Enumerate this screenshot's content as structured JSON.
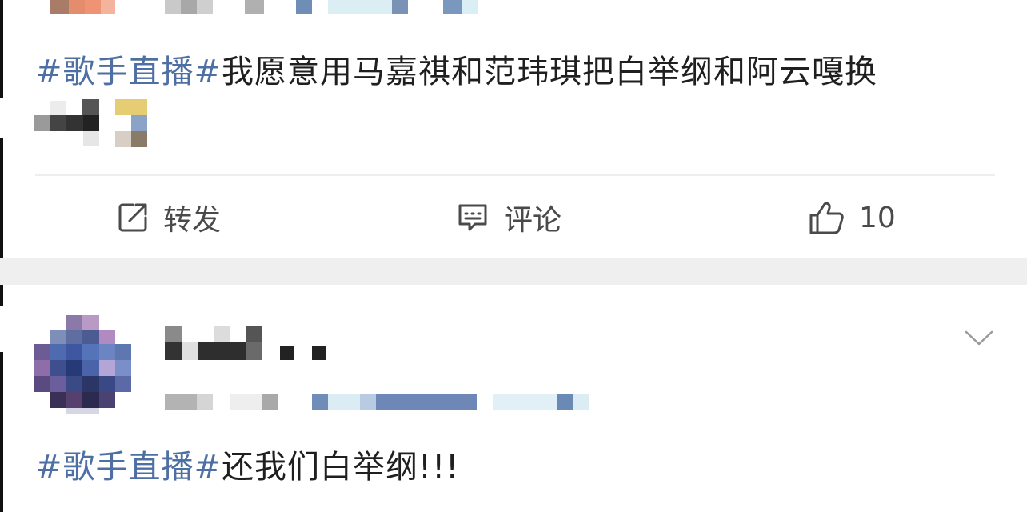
{
  "post1": {
    "hashtag": "#歌手直播#",
    "text": "我愿意用马嘉祺和范玮琪把白举纲和阿云嘎换"
  },
  "actions": {
    "repost_label": "转发",
    "comment_label": "评论",
    "like_count": "10"
  },
  "post2": {
    "hashtag": "#歌手直播#",
    "text": "还我们白举纲!!!"
  },
  "icons": {
    "repost": "repost-icon",
    "comment": "comment-icon",
    "like": "thumbs-up-icon",
    "more": "chevron-down-icon"
  },
  "colors": {
    "hashtag": "#4d6fa3",
    "text": "#1f1f1f",
    "action": "#4a4a4a",
    "separator": "#efefef"
  }
}
